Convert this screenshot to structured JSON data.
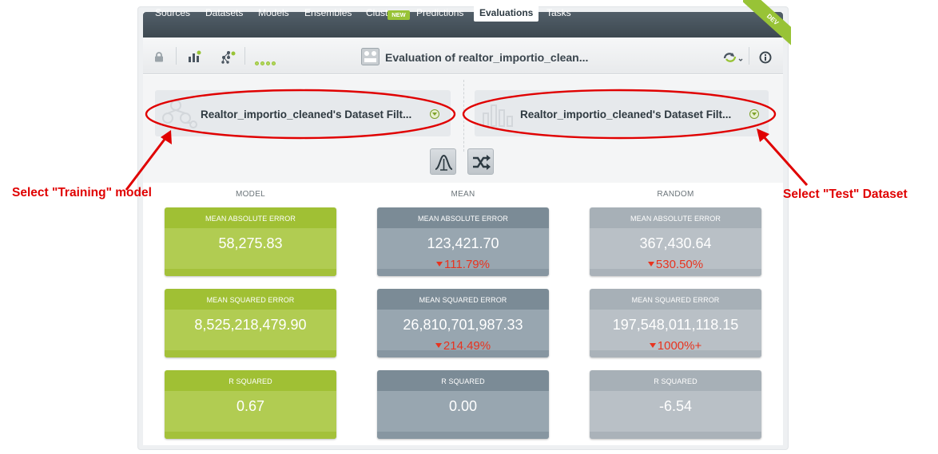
{
  "nav": {
    "items": [
      "Sources",
      "Datasets",
      "Models",
      "Ensembles",
      "Clusters",
      "Predictions",
      "Evaluations",
      "Tasks"
    ],
    "active": "Evaluations",
    "new_badge": "NEW",
    "dev_ribbon": "DEV"
  },
  "toolbar": {
    "title": "Evaluation of realtor_importio_clean...",
    "icons": [
      "lock-icon",
      "bar-chart-icon",
      "network-icon",
      "progress-dots",
      "evaluation-icon",
      "sync-icon",
      "info-icon"
    ]
  },
  "selectors": {
    "left": "Realtor_importio_cleaned's Dataset Filt...",
    "right": "Realtor_importio_cleaned's Dataset Filt..."
  },
  "annotations": {
    "left": "Select \"Training\" model",
    "right": "Select \"Test\" Dataset"
  },
  "columns": {
    "model": "MODEL",
    "mean": "MEAN",
    "random": "RANDOM"
  },
  "metrics": {
    "mae": {
      "label": "MEAN ABSOLUTE ERROR",
      "model": "58,275.83",
      "mean": "123,421.70",
      "mean_pct": "111.79%",
      "random": "367,430.64",
      "random_pct": "530.50%"
    },
    "mse": {
      "label": "MEAN SQUARED ERROR",
      "model": "8,525,218,479.90",
      "mean": "26,810,701,987.33",
      "mean_pct": "214.49%",
      "random": "197,548,011,118.15",
      "random_pct": "1000%+"
    },
    "r2": {
      "label": "R SQUARED",
      "model": "0.67",
      "mean": "0.00",
      "random": "-6.54"
    }
  },
  "colors": {
    "accent": "#98c336",
    "annotation": "#e00000",
    "decline": "#e8331f"
  }
}
